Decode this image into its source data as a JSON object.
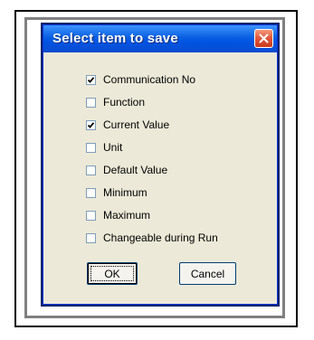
{
  "dialog": {
    "title": "Select item to save",
    "close_icon": "close-icon",
    "items": [
      {
        "label": "Communication No",
        "checked": true
      },
      {
        "label": "Function",
        "checked": false
      },
      {
        "label": "Current Value",
        "checked": true
      },
      {
        "label": "Unit",
        "checked": false
      },
      {
        "label": "Default Value",
        "checked": false
      },
      {
        "label": "Minimum",
        "checked": false
      },
      {
        "label": "Maximum",
        "checked": false
      },
      {
        "label": "Changeable during Run",
        "checked": false
      }
    ],
    "ok_label": "OK",
    "cancel_label": "Cancel"
  },
  "colors": {
    "titlebar": "#0054e3",
    "dialog_bg": "#ece9d8",
    "close_button": "#e2553a"
  }
}
